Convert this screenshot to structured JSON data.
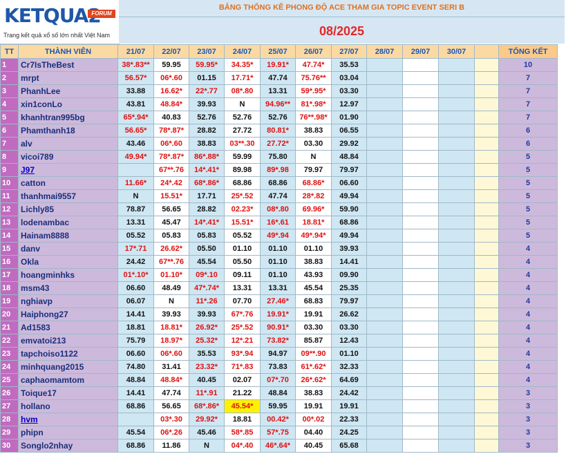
{
  "logo": {
    "word": "KETQUA2",
    "badge": "FORUM",
    "tagline": "Trang kết quả xổ số lớn nhất Việt Nam"
  },
  "title": "BẢNG THỐNG KÊ PHONG ĐỘ ACE THAM GIA TOPIC EVENT SERI B",
  "period": "08/2025",
  "headers": {
    "tt": "TT",
    "member": "THÀNH VIÊN",
    "dates": [
      "21/07",
      "22/07",
      "23/07",
      "24/07",
      "25/07",
      "26/07",
      "27/07",
      "28/07",
      "29/07",
      "30/07"
    ],
    "total": "TỔNG KẾT"
  },
  "rows": [
    {
      "tt": "1",
      "name": "Cr7IsTheBest",
      "c": [
        "38*.83**",
        "59.95",
        "59.95*",
        "34.35*",
        "19.91*",
        "47.74*",
        "35.53"
      ],
      "score": "10"
    },
    {
      "tt": "2",
      "name": "mrpt",
      "c": [
        "56.57*",
        "06*.60",
        "01.15",
        "17.71*",
        "47.74",
        "75.76**",
        "03.04"
      ],
      "score": "7"
    },
    {
      "tt": "3",
      "name": "PhanhLee",
      "c": [
        "33.88",
        "16.62*",
        "22*.77",
        "08*.80",
        "13.31",
        "59*.95*",
        "03.30"
      ],
      "score": "7"
    },
    {
      "tt": "4",
      "name": "xin1conLo",
      "c": [
        "43.81",
        "48.84*",
        "39.93",
        "N",
        "94.96**",
        "81*.98*",
        "12.97"
      ],
      "score": "7"
    },
    {
      "tt": "5",
      "name": "khanhtran995bg",
      "c": [
        "65*.94*",
        "40.83",
        "52.76",
        "52.76",
        "52.76",
        "76**.98*",
        "01.90"
      ],
      "score": "7"
    },
    {
      "tt": "6",
      "name": "Phamthanh18",
      "c": [
        "56.65*",
        "78*.87*",
        "28.82",
        "27.72",
        "80.81*",
        "38.83",
        "06.55"
      ],
      "score": "6"
    },
    {
      "tt": "7",
      "name": "alv",
      "c": [
        "43.46",
        "06*.60",
        "38.83",
        "03**.30",
        "27.72*",
        "03.30",
        "29.92"
      ],
      "score": "6"
    },
    {
      "tt": "8",
      "name": "vicoi789",
      "c": [
        "49.94*",
        "78*.87*",
        "86*.88*",
        "59.99",
        "75.80",
        "N",
        "48.84"
      ],
      "score": "5"
    },
    {
      "tt": "9",
      "name": "J97",
      "c": [
        "",
        "67**.76",
        "14*.41*",
        "89.98",
        "89*.98",
        "79.97",
        "79.97"
      ],
      "score": "5"
    },
    {
      "tt": "10",
      "name": "catton",
      "c": [
        "11.66*",
        "24*.42",
        "68*.86*",
        "68.86",
        "68.86",
        "68.86*",
        "06.60"
      ],
      "score": "5"
    },
    {
      "tt": "11",
      "name": "thanhmai9557",
      "c": [
        "N",
        "15.51*",
        "17.71",
        "25*.52",
        "47.74",
        "28*.82",
        "49.94"
      ],
      "score": "5"
    },
    {
      "tt": "12",
      "name": "Lichly85",
      "c": [
        "78.87",
        "56.65",
        "28.82",
        "02.23*",
        "08*.80",
        "69.96*",
        "59.90"
      ],
      "score": "5"
    },
    {
      "tt": "13",
      "name": "lodenambac",
      "c": [
        "13.31",
        "45.47",
        "14*.41*",
        "15.51*",
        "16*.61",
        "18.81*",
        "68.86"
      ],
      "score": "5"
    },
    {
      "tt": "14",
      "name": "Hainam8888",
      "c": [
        "05.52",
        "05.83",
        "05.83",
        "05.52",
        "49*.94",
        "49*.94*",
        "49.94"
      ],
      "score": "5"
    },
    {
      "tt": "15",
      "name": "danv",
      "c": [
        "17*.71",
        "26.62*",
        "05.50",
        "01.10",
        "01.10",
        "01.10",
        "39.93"
      ],
      "score": "4"
    },
    {
      "tt": "16",
      "name": "Okla",
      "c": [
        "24.42",
        "67**.76",
        "45.54",
        "05.50",
        "01.10",
        "38.83",
        "14.41"
      ],
      "score": "4"
    },
    {
      "tt": "17",
      "name": "hoangminhks",
      "c": [
        "01*.10*",
        "01.10*",
        "09*.10",
        "09.11",
        "01.10",
        "43.93",
        "09.90"
      ],
      "score": "4"
    },
    {
      "tt": "18",
      "name": "msm43",
      "c": [
        "06.60",
        "48.49",
        "47*.74*",
        "13.31",
        "13.31",
        "45.54",
        "25.35"
      ],
      "score": "4"
    },
    {
      "tt": "19",
      "name": "nghiavp",
      "c": [
        "06.07",
        "N",
        "11*.26",
        "07.70",
        "27.46*",
        "68.83",
        "79.97"
      ],
      "score": "4"
    },
    {
      "tt": "20",
      "name": "Haiphong27",
      "c": [
        "14.41",
        "39.93",
        "39.93",
        "67*.76",
        "19.91*",
        "19.91",
        "26.62"
      ],
      "score": "4"
    },
    {
      "tt": "21",
      "name": "Ad1583",
      "c": [
        "18.81",
        "18.81*",
        "26.92*",
        "25*.52",
        "90.91*",
        "03.30",
        "03.30"
      ],
      "score": "4"
    },
    {
      "tt": "22",
      "name": "emvatoi213",
      "c": [
        "75.79",
        "18.97*",
        "25.32*",
        "12*.21",
        "73.82*",
        "85.87",
        "12.43"
      ],
      "score": "4"
    },
    {
      "tt": "23",
      "name": "tapchoiso1122",
      "c": [
        "06.60",
        "06*.60",
        "35.53",
        "93*.94",
        "94.97",
        "09**.90",
        "01.10"
      ],
      "score": "4"
    },
    {
      "tt": "24",
      "name": "minhquang2015",
      "c": [
        "74.80",
        "31.41",
        "23.32*",
        "71*.83",
        "73.83",
        "61*.62*",
        "32.33"
      ],
      "score": "4"
    },
    {
      "tt": "25",
      "name": "caphaomamtom",
      "c": [
        "48.84",
        "48.84*",
        "40.45",
        "02.07",
        "07*.70",
        "26*.62*",
        "64.69"
      ],
      "score": "4"
    },
    {
      "tt": "26",
      "name": "Toique17",
      "c": [
        "14.41",
        "47.74",
        "11*.91",
        "21.22",
        "48.84",
        "38.83",
        "24.42"
      ],
      "score": "3"
    },
    {
      "tt": "27",
      "name": "hollano",
      "c": [
        "68.86",
        "56.65",
        "68*.86*",
        "45.54*",
        "59.95",
        "19.91",
        "19.91"
      ],
      "score": "3"
    },
    {
      "tt": "28",
      "name": "hvm",
      "c": [
        "",
        "03*.30",
        "29.92*",
        "18.81",
        "00.42*",
        "00*.02",
        "22.33"
      ],
      "score": "3"
    },
    {
      "tt": "29",
      "name": "phipn",
      "c": [
        "45.54",
        "06*.26",
        "45.46",
        "58*.85",
        "57*.75",
        "04.40",
        "24.25"
      ],
      "score": "3"
    },
    {
      "tt": "30",
      "name": "Songlo2nhay",
      "c": [
        "68.86",
        "11.86",
        "N",
        "04*.40",
        "46*.64*",
        "40.45",
        "65.68"
      ],
      "score": "3"
    }
  ]
}
